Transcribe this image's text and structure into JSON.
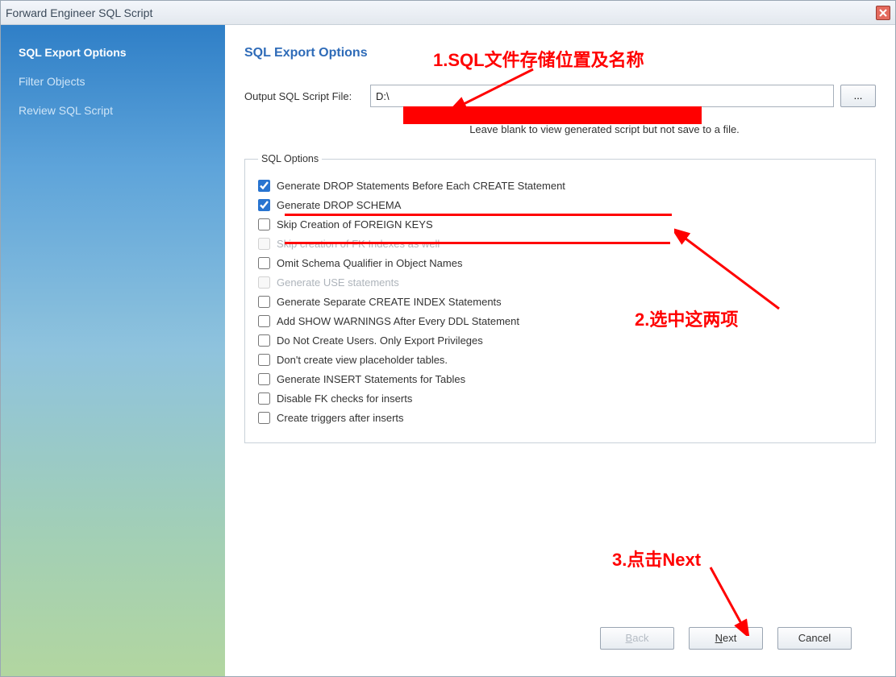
{
  "window": {
    "title": "Forward Engineer SQL Script"
  },
  "sidebar": {
    "items": [
      {
        "label": "SQL Export Options",
        "active": true
      },
      {
        "label": "Filter Objects",
        "active": false
      },
      {
        "label": "Review SQL Script",
        "active": false
      }
    ]
  },
  "main": {
    "heading": "SQL Export Options",
    "output_label": "Output SQL Script File:",
    "output_value": "D:\\",
    "browse_label": "...",
    "hint": "Leave blank to view generated script but not save to a file.",
    "options_legend": "SQL Options",
    "options": [
      {
        "label": "Generate DROP Statements Before Each CREATE Statement",
        "checked": true,
        "disabled": false
      },
      {
        "label": "Generate DROP SCHEMA",
        "checked": true,
        "disabled": false
      },
      {
        "label": "Skip Creation of FOREIGN KEYS",
        "checked": false,
        "disabled": false
      },
      {
        "label": "Skip creation of FK Indexes as well",
        "checked": false,
        "disabled": true
      },
      {
        "label": "Omit Schema Qualifier in Object Names",
        "checked": false,
        "disabled": false
      },
      {
        "label": "Generate USE statements",
        "checked": false,
        "disabled": true
      },
      {
        "label": "Generate Separate CREATE INDEX Statements",
        "checked": false,
        "disabled": false
      },
      {
        "label": "Add SHOW WARNINGS After Every DDL Statement",
        "checked": false,
        "disabled": false
      },
      {
        "label": "Do Not Create Users. Only Export Privileges",
        "checked": false,
        "disabled": false
      },
      {
        "label": "Don't create view placeholder tables.",
        "checked": false,
        "disabled": false
      },
      {
        "label": "Generate INSERT Statements for Tables",
        "checked": false,
        "disabled": false
      },
      {
        "label": "Disable FK checks for inserts",
        "checked": false,
        "disabled": false
      },
      {
        "label": "Create triggers after inserts",
        "checked": false,
        "disabled": false
      }
    ]
  },
  "buttons": {
    "back": "Back",
    "next": "Next",
    "cancel": "Cancel"
  },
  "annotations": {
    "a1": "1.SQL文件存储位置及名称",
    "a2": "2.选中这两项",
    "a3": "3.点击Next"
  }
}
